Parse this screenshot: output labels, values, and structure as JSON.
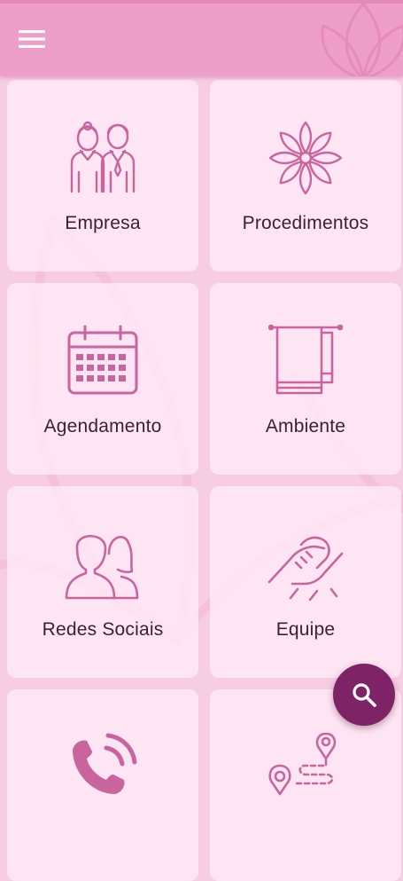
{
  "app_bar": {
    "menu_icon": "hamburger-menu-icon",
    "decor_icon": "lotus-icon"
  },
  "tiles": [
    {
      "label": "Empresa",
      "icon": "couple-people-icon"
    },
    {
      "label": "Procedimentos",
      "icon": "mandala-flower-icon"
    },
    {
      "label": "Agendamento",
      "icon": "calendar-icon"
    },
    {
      "label": "Ambiente",
      "icon": "towel-rack-icon"
    },
    {
      "label": "Redes Sociais",
      "icon": "users-silhouette-icon"
    },
    {
      "label": "Equipe",
      "icon": "handshake-icon"
    },
    {
      "label": "",
      "icon": "phone-icon"
    },
    {
      "label": "",
      "icon": "route-map-icon"
    }
  ],
  "fab": {
    "icon": "search-icon"
  },
  "colors": {
    "app_bar": "#ed9ec9",
    "background": "#f7cde3",
    "tile": "#fde7f3",
    "icon_stroke": "#c9649f",
    "label_text": "#3a2233",
    "fab": "#7e2466"
  }
}
